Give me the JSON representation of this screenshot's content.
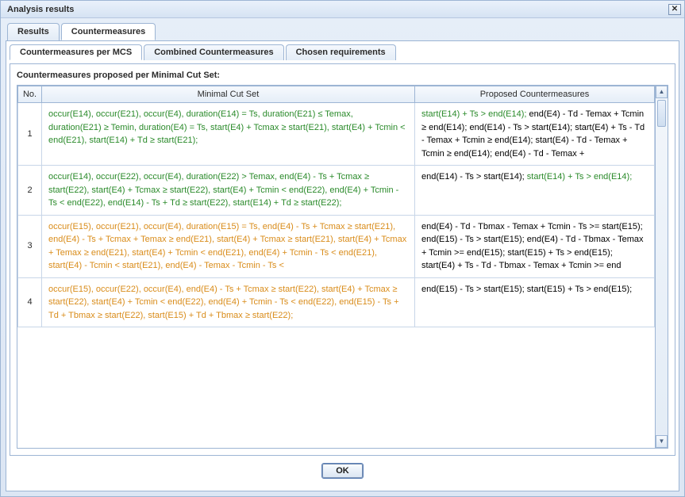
{
  "window": {
    "title": "Analysis results"
  },
  "tabs": {
    "results": "Results",
    "countermeasures": "Countermeasures"
  },
  "subtabs": {
    "per_mcs": "Countermeasures per MCS",
    "combined": "Combined Countermeasures",
    "chosen": "Chosen requirements"
  },
  "section_heading": "Countermeasures proposed per Minimal Cut Set:",
  "columns": {
    "no": "No.",
    "mcs": "Minimal Cut Set",
    "proposed": "Proposed Countermeasures"
  },
  "rows": [
    {
      "no": "1",
      "mcs_color": "g",
      "mcs": "occur(E14), occur(E21), occur(E4), duration(E14) = Ts, duration(E21) ≤ Temax, duration(E21) ≥ Temin, duration(E4) = Ts, start(E4) + Tcmax ≥ start(E21), start(E4) + Tcmin < end(E21), start(E14) + Td ≥ start(E21);",
      "proposed_segments": [
        {
          "c": "g",
          "t": "start(E14) + Ts > end(E14);"
        },
        {
          "c": "k",
          "t": " end(E4) - Td - Temax + Tcmin ≥ end(E14); end(E14) - Ts > start(E14); start(E4) + Ts - Td - Temax + Tcmin ≥ end(E14); start(E4) - Td - Temax + Tcmin ≥ end(E14); end(E4) - Td - Temax +"
        }
      ]
    },
    {
      "no": "2",
      "mcs_color": "g",
      "mcs": "occur(E14), occur(E22), occur(E4), duration(E22) > Temax, end(E4) - Ts + Tcmax ≥ start(E22), start(E4) + Tcmax ≥ start(E22), start(E4) + Tcmin < end(E22), end(E4) + Tcmin - Ts < end(E22), end(E14) - Ts + Td ≥ start(E22), start(E14) + Td ≥ start(E22);",
      "proposed_segments": [
        {
          "c": "k",
          "t": "end(E14) - Ts > start(E14); "
        },
        {
          "c": "g",
          "t": "start(E14) + Ts > end(E14);"
        }
      ]
    },
    {
      "no": "3",
      "mcs_color": "o",
      "mcs": "occur(E15), occur(E21), occur(E4), duration(E15) = Ts, end(E4) - Ts + Tcmax ≥ start(E21), end(E4) - Ts + Tcmax + Temax ≥ end(E21), start(E4) + Tcmax ≥ start(E21), start(E4) + Tcmax + Temax ≥ end(E21), start(E4) + Tcmin < end(E21), end(E4) + Tcmin - Ts < end(E21), start(E4) - Tcmin < start(E21), end(E4) - Temax - Tcmin - Ts <",
      "proposed_segments": [
        {
          "c": "k",
          "t": "end(E4) - Td - Tbmax - Temax + Tcmin - Ts >= start(E15); end(E15) - Ts > start(E15); end(E4) - Td - Tbmax - Temax + Tcmin >= end(E15); start(E15) + Ts > end(E15); start(E4) + Ts - Td - Tbmax - Temax + Tcmin >= end"
        }
      ]
    },
    {
      "no": "4",
      "mcs_color": "o",
      "mcs": "occur(E15), occur(E22), occur(E4), end(E4) - Ts + Tcmax ≥ start(E22), start(E4) + Tcmax ≥ start(E22), start(E4) + Tcmin < end(E22), end(E4) + Tcmin - Ts < end(E22), end(E15) - Ts + Td + Tbmax ≥ start(E22), start(E15) + Td + Tbmax ≥ start(E22);",
      "proposed_segments": [
        {
          "c": "k",
          "t": "end(E15) - Ts > start(E15); start(E15) + Ts > end(E15);"
        }
      ]
    }
  ],
  "buttons": {
    "ok": "OK"
  },
  "icons": {
    "close": "✕",
    "up": "▲",
    "down": "▼"
  }
}
